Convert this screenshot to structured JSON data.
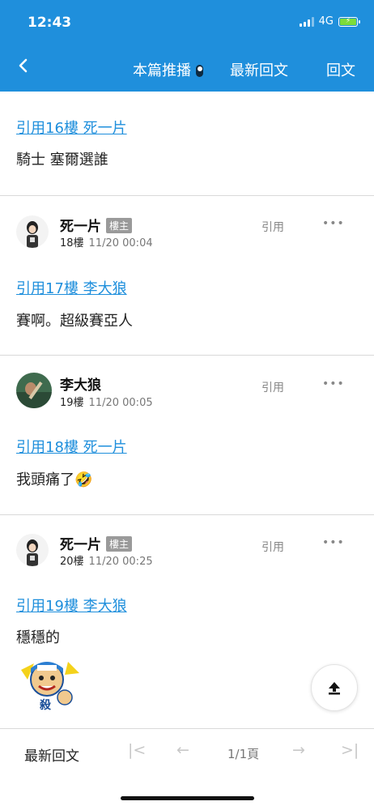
{
  "status": {
    "time": "12:43",
    "network": "4G"
  },
  "nav": {
    "back_icon": "chevron-left-icon",
    "push_label": "本篇推播",
    "latest_label": "最新回文",
    "reply_label": "回文"
  },
  "posts": [
    {
      "quote": "引用16樓 死一片",
      "text": "騎士 塞爾選誰"
    },
    {
      "author": "死一片",
      "badge": "樓主",
      "floor": "18樓",
      "time": "11/20 00:04",
      "quote_btn": "引用",
      "more": "•••",
      "quote": "引用17樓 李大狼",
      "text": "賽啊。超級賽亞人"
    },
    {
      "author": "李大狼",
      "floor": "19樓",
      "time": "11/20 00:05",
      "quote_btn": "引用",
      "more": "•••",
      "quote": "引用18樓 死一片",
      "text": "我頭痛了🤣"
    },
    {
      "author": "死一片",
      "badge": "樓主",
      "floor": "20樓",
      "time": "11/20 00:25",
      "quote_btn": "引用",
      "more": "•••",
      "quote": "引用19樓 李大狼",
      "text": "穩穩的",
      "sticker_text": "殺"
    }
  ],
  "bottom": {
    "latest_label": "最新回文",
    "first_icon": "|<",
    "prev_icon": "←",
    "page_label": "1/1頁",
    "next_icon": "→",
    "last_icon": ">|"
  },
  "colors": {
    "brand": "#1f8fdc",
    "link": "#1f8fdc",
    "badge": "#9a9a9a",
    "divider": "#d9d9d9"
  }
}
